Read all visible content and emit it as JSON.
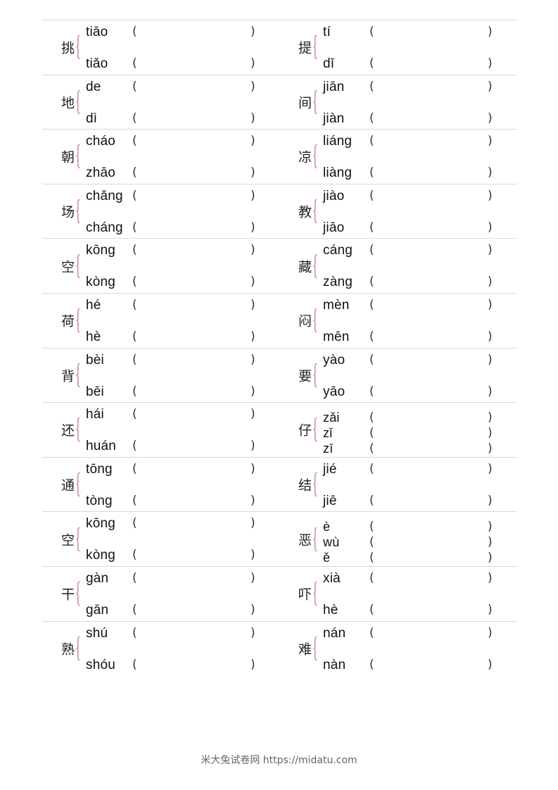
{
  "rows": [
    {
      "left": {
        "char": "挑",
        "readings": [
          "tiāo",
          "tiǎo"
        ]
      },
      "right": {
        "char": "提",
        "readings": [
          "tí",
          "dī"
        ]
      }
    },
    {
      "left": {
        "char": "地",
        "readings": [
          "de",
          "dì"
        ]
      },
      "right": {
        "char": "间",
        "readings": [
          "jiān",
          "jiàn"
        ]
      }
    },
    {
      "left": {
        "char": "朝",
        "readings": [
          "cháo",
          "zhāo"
        ]
      },
      "right": {
        "char": "凉",
        "readings": [
          "liáng",
          "liàng"
        ]
      }
    },
    {
      "left": {
        "char": "场",
        "readings": [
          "chǎng",
          "cháng"
        ]
      },
      "right": {
        "char": "教",
        "readings": [
          "jiào",
          "jiāo"
        ]
      }
    },
    {
      "left": {
        "char": "空",
        "readings": [
          "kōng",
          "kòng"
        ]
      },
      "right": {
        "char": "藏",
        "readings": [
          "cáng",
          "zàng"
        ]
      }
    },
    {
      "left": {
        "char": "荷",
        "readings": [
          "hé",
          "hè"
        ]
      },
      "right": {
        "char": "闷",
        "readings": [
          "mèn",
          "mēn"
        ]
      }
    },
    {
      "left": {
        "char": "背",
        "readings": [
          "bèi",
          "bēi"
        ]
      },
      "right": {
        "char": "要",
        "readings": [
          "yào",
          "yāo"
        ]
      }
    },
    {
      "left": {
        "char": "还",
        "readings": [
          "hái",
          "huán"
        ]
      },
      "right": {
        "char": "仔",
        "readings": [
          "zǎi",
          "zǐ",
          "zī"
        ]
      }
    },
    {
      "left": {
        "char": "通",
        "readings": [
          "tōng",
          "tòng"
        ]
      },
      "right": {
        "char": "结",
        "readings": [
          "jié",
          "jiē"
        ]
      }
    },
    {
      "left": {
        "char": "空",
        "readings": [
          "kōng",
          "kòng"
        ]
      },
      "right": {
        "char": "恶",
        "readings": [
          "è",
          "wù",
          "ě"
        ]
      }
    },
    {
      "left": {
        "char": "干",
        "readings": [
          "gàn",
          "gān"
        ]
      },
      "right": {
        "char": "吓",
        "readings": [
          "xià",
          "hè"
        ]
      }
    },
    {
      "left": {
        "char": "熟",
        "readings": [
          "shú",
          "shóu"
        ]
      },
      "right": {
        "char": "难",
        "readings": [
          "nán",
          "nàn"
        ]
      }
    }
  ],
  "paren_open": "(",
  "paren_close": ")",
  "footer": {
    "text": "米大兔试卷网 https://midatu.com"
  },
  "colors": {
    "brace": "#c97a7a",
    "divider": "#d9d9d9"
  }
}
